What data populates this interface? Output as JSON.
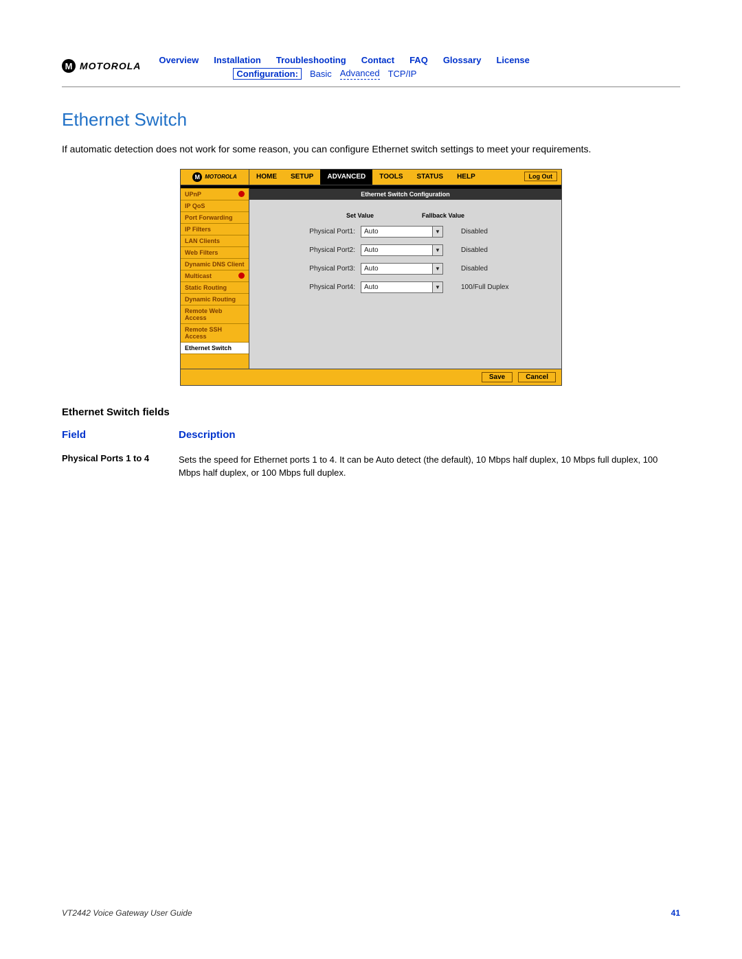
{
  "logo_text": "MOTOROLA",
  "top_nav": [
    "Overview",
    "Installation",
    "Troubleshooting",
    "Contact",
    "FAQ",
    "Glossary",
    "License"
  ],
  "sub_nav": {
    "label": "Configuration:",
    "items": [
      "Basic",
      "Advanced",
      "TCP/IP"
    ],
    "active": 1
  },
  "section_title": "Ethernet Switch",
  "intro": "If automatic detection does not work for some reason, you can configure Ethernet switch settings to meet your requirements.",
  "app": {
    "brand": "MOTOROLA",
    "menu": [
      "HOME",
      "SETUP",
      "ADVANCED",
      "TOOLS",
      "STATUS",
      "HELP"
    ],
    "menu_active": 2,
    "logout": "Log Out",
    "sidebar": [
      {
        "label": "UPnP",
        "dot": true
      },
      {
        "label": "IP QoS"
      },
      {
        "label": "Port Forwarding"
      },
      {
        "label": "IP Filters"
      },
      {
        "label": "LAN Clients"
      },
      {
        "label": "Web Filters"
      },
      {
        "label": "Dynamic DNS Client"
      },
      {
        "label": "Multicast",
        "dot": true
      },
      {
        "label": "Static Routing"
      },
      {
        "label": "Dynamic Routing"
      },
      {
        "label": "Remote Web Access"
      },
      {
        "label": "Remote SSH Access"
      },
      {
        "label": "Ethernet Switch",
        "active": true
      }
    ],
    "banner": "Ethernet Switch Configuration",
    "col_set": "Set Value",
    "col_fb": "Fallback Value",
    "ports": [
      {
        "label": "Physical Port1:",
        "value": "Auto",
        "fallback": "Disabled"
      },
      {
        "label": "Physical Port2:",
        "value": "Auto",
        "fallback": "Disabled"
      },
      {
        "label": "Physical Port3:",
        "value": "Auto",
        "fallback": "Disabled"
      },
      {
        "label": "Physical Port4:",
        "value": "Auto",
        "fallback": "100/Full Duplex"
      }
    ],
    "save": "Save",
    "cancel": "Cancel"
  },
  "fields_title": "Ethernet Switch fields",
  "col_field": "Field",
  "col_desc": "Description",
  "row": {
    "name": "Physical Ports 1 to 4",
    "desc": "Sets the speed for Ethernet ports 1 to 4. It can be Auto detect (the default), 10 Mbps half duplex, 10 Mbps full duplex, 100 Mbps half duplex, or 100 Mbps full duplex."
  },
  "footer_left": "VT2442 Voice Gateway User Guide",
  "page_number": "41"
}
